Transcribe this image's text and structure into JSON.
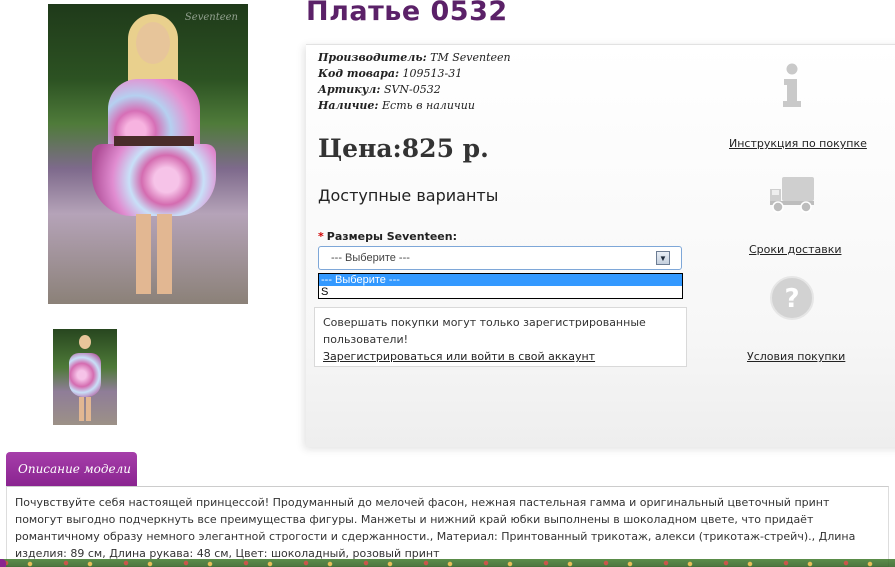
{
  "product": {
    "title": "Платье 0532",
    "watermark": "Seventeen",
    "manufacturer_label": "Производитель:",
    "manufacturer_value": "TM Seventeen",
    "code_label": "Код товара:",
    "code_value": "109513-31",
    "sku_label": "Артикул:",
    "sku_value": "SVN-0532",
    "availability_label": "Наличие:",
    "availability_value": "Есть в наличии",
    "price": "Цена:825 р."
  },
  "variants": {
    "heading": "Доступные варианты",
    "required_mark": "*",
    "size_label": "Размеры Seventeen:",
    "select_value": "--- Выберите ---",
    "options": [
      "--- Выберите ---",
      "S"
    ],
    "selected_index": 0
  },
  "login_notice": {
    "text": "Совершать покупки могут только зарегистрированные пользователи!",
    "link": "Зарегистрироваться или войти в свой аккаунт"
  },
  "side_links": {
    "instruction": "Инструкция по покупке",
    "delivery": "Сроки доставки",
    "terms": "Условия покупки"
  },
  "description": {
    "tab_label": "Описание модели",
    "text": "Почувствуйте себя настоящей принцессой! Продуманный до мелочей фасон, нежная пастельная гамма и оригинальный цветочный принт помогут выгодно подчеркнуть все преимущества фигуры. Манжеты и нижний край юбки выполнены в шоколадном цвете, что придаёт романтичному образу немного элегантной строгости и сдержанности., Материал: Принтованный трикотаж, алекси (трикотаж-стрейч)., Длина изделия: 89 см, Длина рукава: 48 см, Цвет: шоколадный, розовый принт"
  },
  "colors": {
    "title": "#5b2168",
    "tab": "#8a2490",
    "dropdown_highlight": "#3399ff",
    "required": "#d00000"
  },
  "icons": [
    "info-icon",
    "delivery-truck-icon",
    "question-icon",
    "select-arrow-icon"
  ]
}
